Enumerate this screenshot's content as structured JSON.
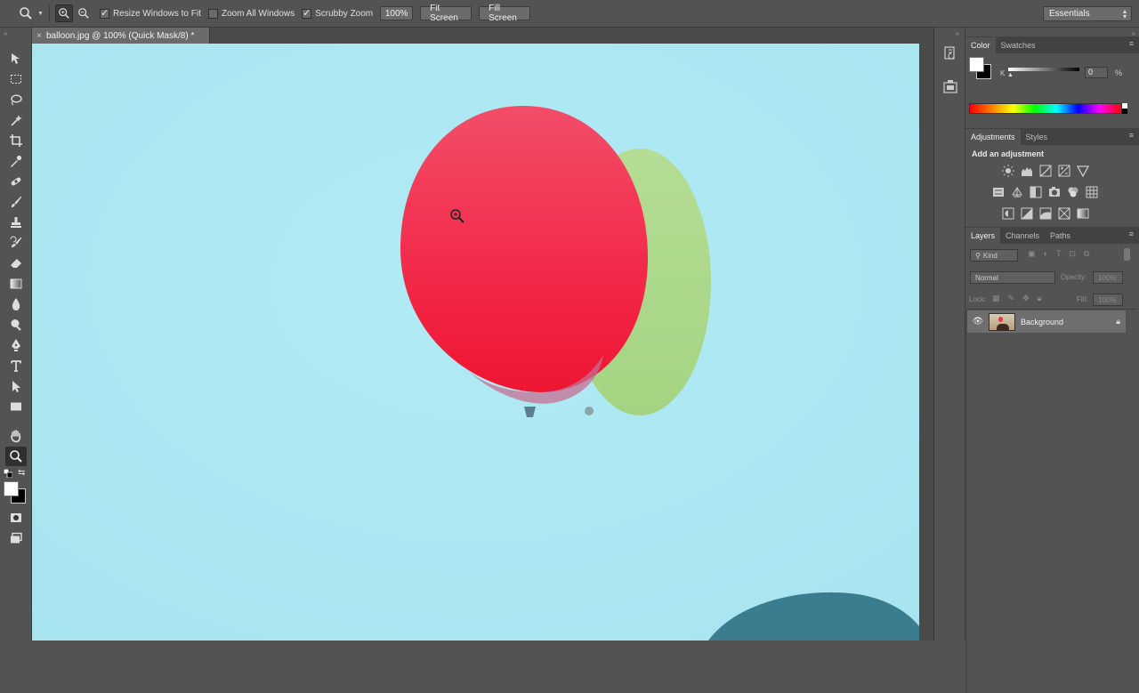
{
  "options_bar": {
    "resize_windows": {
      "label": "Resize Windows to Fit",
      "checked": true
    },
    "zoom_all_windows": {
      "label": "Zoom All Windows",
      "checked": false
    },
    "scrubby_zoom": {
      "label": "Scrubby Zoom",
      "checked": true
    },
    "btn_100": "100%",
    "btn_fit": "Fit Screen",
    "btn_fill": "Fill Screen",
    "workspace": "Essentials"
  },
  "document": {
    "tab_title": "balloon.jpg @ 100% (Quick Mask/8) *",
    "close": "×"
  },
  "tools": [
    "move-tool",
    "marquee-tool",
    "lasso-tool",
    "quick-selection-tool",
    "crop-tool",
    "eyedropper-tool",
    "healing-brush-tool",
    "brush-tool",
    "clone-stamp-tool",
    "history-brush-tool",
    "eraser-tool",
    "gradient-tool",
    "blur-tool",
    "dodge-tool",
    "pen-tool",
    "type-tool",
    "path-selection-tool",
    "rectangle-tool",
    "hand-tool",
    "zoom-tool"
  ],
  "panels": {
    "color": {
      "tabs": [
        "Color",
        "Swatches"
      ],
      "k_label": "K",
      "k_value": "0",
      "k_unit": "%"
    },
    "adjustments": {
      "tabs": [
        "Adjustments",
        "Styles"
      ],
      "heading": "Add an adjustment"
    },
    "layers": {
      "tabs": [
        "Layers",
        "Channels",
        "Paths"
      ],
      "kind": "Kind",
      "blend_mode": "Normal",
      "opacity_label": "Opacity:",
      "opacity_value": "100%",
      "lock_label": "Lock:",
      "fill_label": "Fill:",
      "fill_value": "100%",
      "layer_name": "Background"
    }
  },
  "colors": {
    "sky": "#aee8f3",
    "red_balloon": "#f0334a",
    "green_balloon": "#a9d88a",
    "panel_bg": "#535353"
  }
}
